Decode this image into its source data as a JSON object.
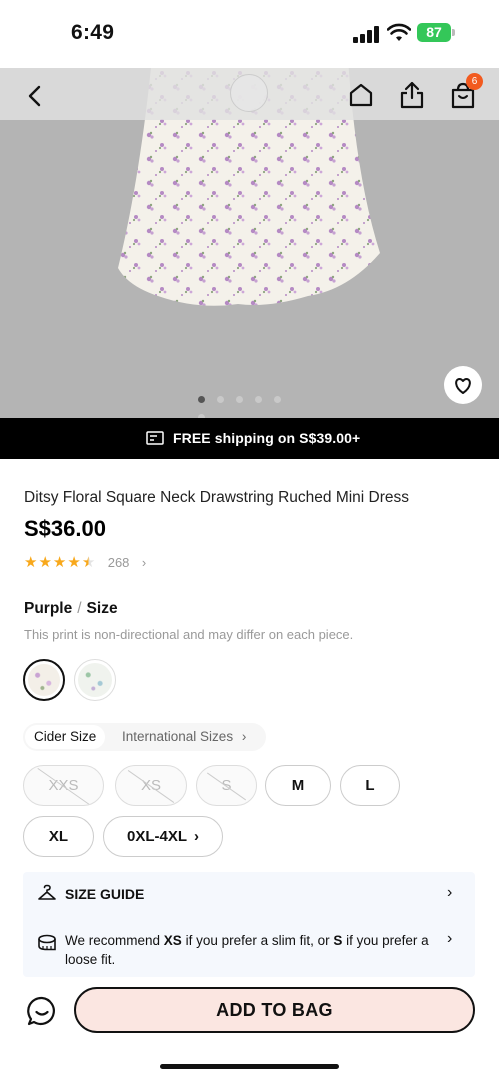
{
  "status_bar": {
    "time": "6:49",
    "battery": "87"
  },
  "header": {
    "cart_count": "6",
    "icons": [
      "back-icon",
      "home-icon",
      "share-icon",
      "bag-icon"
    ]
  },
  "gallery": {
    "image_count": 6,
    "active_index": 0
  },
  "shipping_banner": {
    "text": "FREE shipping on S$39.00+"
  },
  "product": {
    "title": "Ditsy Floral Square Neck Drawstring Ruched Mini Dress",
    "price": "S$36.00",
    "rating": 4.5,
    "review_count": "268"
  },
  "color": {
    "label": "Purple",
    "separator": "/",
    "size_label": "Size",
    "note": "This print is non-directional and may differ on each piece."
  },
  "size_tabs": {
    "active": "Cider Size",
    "inactive": "International Sizes"
  },
  "sizes": [
    {
      "label": "XXS",
      "available": false
    },
    {
      "label": "XS",
      "available": false
    },
    {
      "label": "S",
      "available": false
    },
    {
      "label": "M",
      "available": true
    },
    {
      "label": "L",
      "available": true
    },
    {
      "label": "XL",
      "available": true
    },
    {
      "label": "0XL-4XL",
      "available": true
    }
  ],
  "size_guide": {
    "label": "SIZE GUIDE",
    "rec_pre": "We recommend ",
    "rec_size1": "XS",
    "rec_mid": " if you prefer a slim fit, or ",
    "rec_size2": "S",
    "rec_post": " if you prefer a loose fit."
  },
  "footer": {
    "add_to_bag": "ADD TO BAG"
  },
  "colors": {
    "accent": "#f25a1f",
    "add_bg": "#fbe6e1",
    "star": "#f8a81b",
    "battery": "#34c759"
  }
}
